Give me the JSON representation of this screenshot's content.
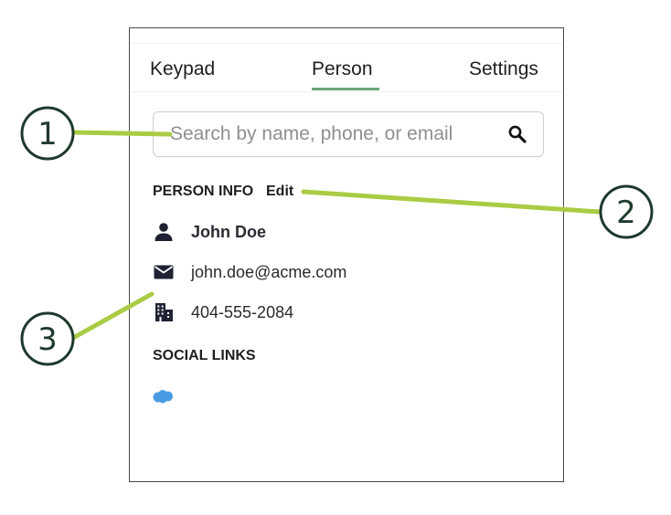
{
  "tabs": [
    {
      "label": "Keypad"
    },
    {
      "label": "Person",
      "active": true
    },
    {
      "label": "Settings"
    }
  ],
  "search": {
    "placeholder": "Search by name, phone, or email",
    "value": ""
  },
  "person_info": {
    "heading": "PERSON INFO",
    "edit_label": "Edit",
    "name": "John Doe",
    "email": "john.doe@acme.com",
    "phone": "404-555-2084"
  },
  "social_links": {
    "heading": "SOCIAL LINKS",
    "items": [
      {
        "icon": "salesforce-cloud-icon",
        "color": "#4a9be3"
      }
    ]
  },
  "callouts": [
    {
      "number": "1"
    },
    {
      "number": "2"
    },
    {
      "number": "3"
    }
  ],
  "colors": {
    "tab_active_underline": "#6ba47e",
    "callout_line": "#a9cc44",
    "callout_circle": "#1e3a2c",
    "salesforce_blue": "#4a9be3"
  }
}
